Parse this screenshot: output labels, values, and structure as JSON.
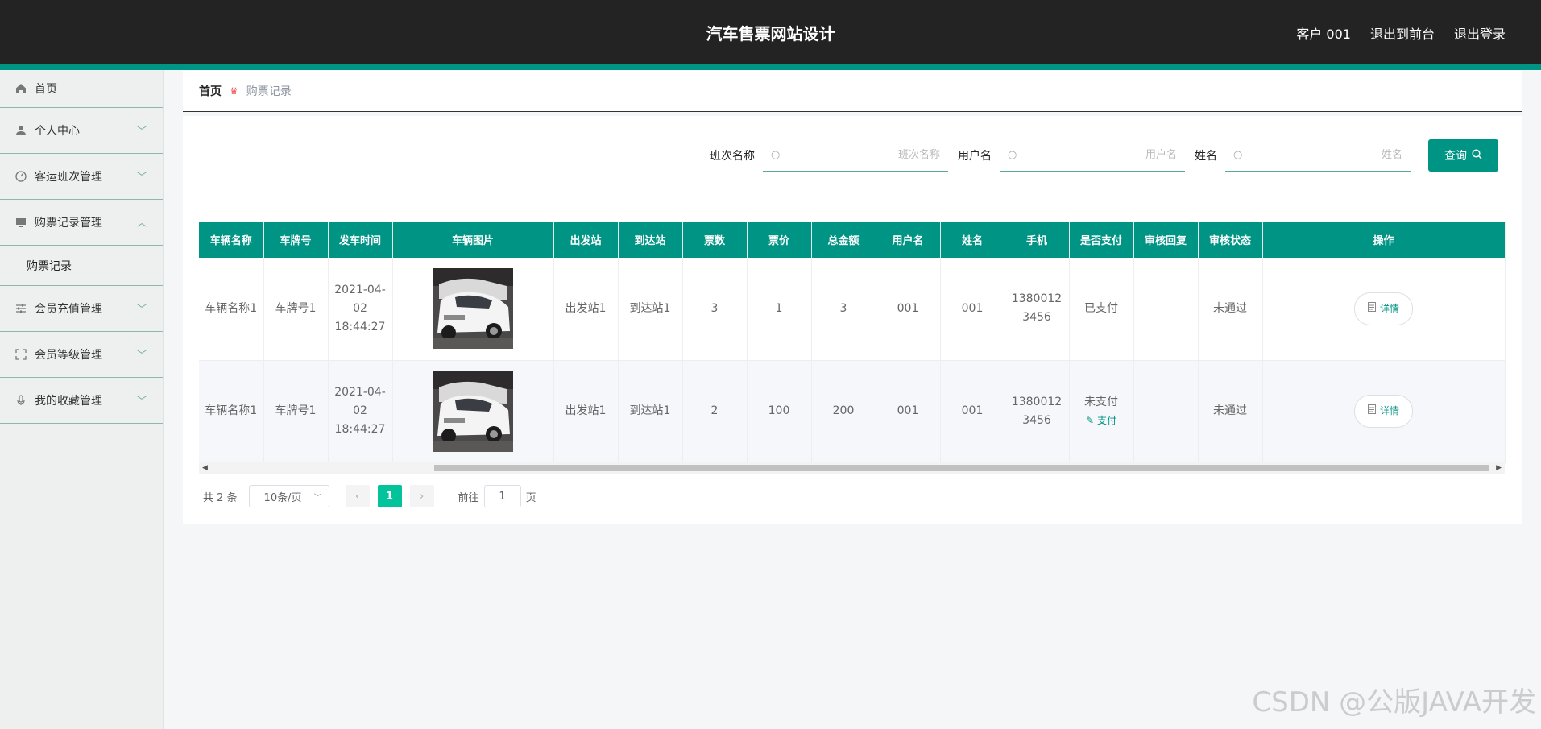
{
  "header": {
    "title": "汽车售票网站设计",
    "user": "客户 001",
    "front_link": "退出到前台",
    "logout": "退出登录"
  },
  "sidebar": {
    "items": [
      {
        "label": "首页",
        "icon": "home-icon"
      },
      {
        "label": "个人中心",
        "icon": "user-icon"
      },
      {
        "label": "客运班次管理",
        "icon": "dashboard-icon"
      },
      {
        "label": "购票记录管理",
        "icon": "monitor-icon",
        "sub": "购票记录"
      },
      {
        "label": "会员充值管理",
        "icon": "sliders-icon"
      },
      {
        "label": "会员等级管理",
        "icon": "fullscreen-icon"
      },
      {
        "label": "我的收藏管理",
        "icon": "microphone-icon"
      }
    ]
  },
  "breadcrumb": {
    "home": "首页",
    "current": "购票记录"
  },
  "search": {
    "f1_label": "班次名称",
    "f1_placeholder": "班次名称",
    "f2_label": "用户名",
    "f2_placeholder": "用户名",
    "f3_label": "姓名",
    "f3_placeholder": "姓名",
    "button": "查询"
  },
  "table": {
    "headers": [
      "车辆名称",
      "车牌号",
      "发车时间",
      "车辆图片",
      "出发站",
      "到达站",
      "票数",
      "票价",
      "总金额",
      "用户名",
      "姓名",
      "手机",
      "是否支付",
      "审核回复",
      "审核状态",
      "操作"
    ],
    "rows": [
      {
        "name": "车辆名称1",
        "plate": "车牌号1",
        "time": "2021-04-02 18:44:27",
        "from": "出发站1",
        "to": "到达站1",
        "tickets": "3",
        "price": "1",
        "total": "3",
        "username": "001",
        "realname": "001",
        "phone": "13800123456",
        "paid": "已支付",
        "reply": "",
        "status": "未通过",
        "action": "详情"
      },
      {
        "name": "车辆名称1",
        "plate": "车牌号1",
        "time": "2021-04-02 18:44:27",
        "from": "出发站1",
        "to": "到达站1",
        "tickets": "2",
        "price": "100",
        "total": "200",
        "username": "001",
        "realname": "001",
        "phone": "13800123456",
        "paid": "未支付",
        "pay_action": "支付",
        "reply": "",
        "status": "未通过",
        "action": "详情"
      }
    ]
  },
  "pager": {
    "total": "共 2 条",
    "page_size": "10条/页",
    "current": "1",
    "goto_prefix": "前往",
    "goto_value": "1",
    "goto_suffix": "页"
  },
  "watermark": "CSDN @公版JAVA开发"
}
